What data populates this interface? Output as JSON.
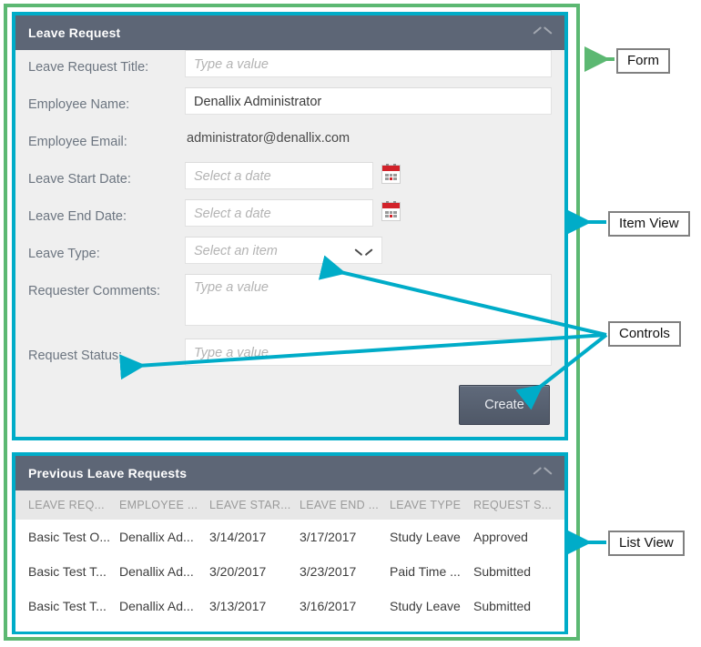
{
  "form_panel": {
    "title": "Leave Request",
    "collapse_icon": "chevron-up-icon",
    "fields": [
      {
        "label": "Leave Request Title:",
        "type": "text",
        "value": "",
        "placeholder": "Type a value"
      },
      {
        "label": "Employee Name:",
        "type": "text",
        "value": "Denallix Administrator",
        "placeholder": ""
      },
      {
        "label": "Employee Email:",
        "type": "static",
        "value": "administrator@denallix.com",
        "placeholder": ""
      },
      {
        "label": "Leave Start Date:",
        "type": "date",
        "value": "",
        "placeholder": "Select a date",
        "icon": "calendar-icon"
      },
      {
        "label": "Leave End Date:",
        "type": "date",
        "value": "",
        "placeholder": "Select a date",
        "icon": "calendar-icon"
      },
      {
        "label": "Leave Type:",
        "type": "select",
        "value": "",
        "placeholder": "Select an item",
        "icon": "chevron-down-icon"
      },
      {
        "label": "Requester Comments:",
        "type": "textarea",
        "value": "",
        "placeholder": "Type a value"
      },
      {
        "label": "Request Status:",
        "type": "text",
        "value": "",
        "placeholder": "Type a value"
      }
    ],
    "submit_label": "Create"
  },
  "list_panel": {
    "title": "Previous Leave Requests",
    "collapse_icon": "chevron-up-icon",
    "columns": [
      "LEAVE REQ...",
      "EMPLOYEE ...",
      "LEAVE STAR...",
      "LEAVE END ...",
      "LEAVE TYPE",
      "REQUEST S..."
    ],
    "rows": [
      [
        "Basic Test O...",
        "Denallix Ad...",
        "3/14/2017",
        "3/17/2017",
        "Study Leave",
        "Approved"
      ],
      [
        "Basic Test T...",
        "Denallix Ad...",
        "3/20/2017",
        "3/23/2017",
        "Paid Time ...",
        "Submitted"
      ],
      [
        "Basic Test T...",
        "Denallix Ad...",
        "3/13/2017",
        "3/16/2017",
        "Study Leave",
        "Submitted"
      ]
    ]
  },
  "annotations": {
    "form": "Form",
    "item_view": "Item View",
    "controls": "Controls",
    "list_view": "List View"
  },
  "colors": {
    "header_slate": "#5d6676",
    "panel_border_teal": "#00acc8",
    "outer_border_green": "#5cb872",
    "arrow_teal": "#00acc8",
    "arrow_green": "#5cb872",
    "calendar_red": "#d2222a",
    "form_background": "#efefef"
  }
}
